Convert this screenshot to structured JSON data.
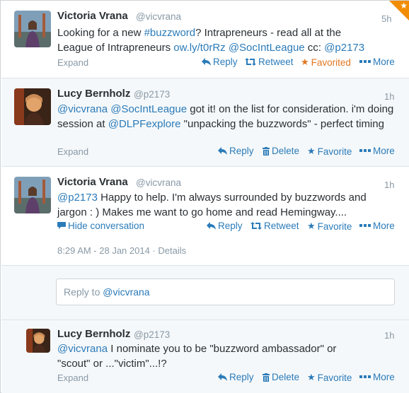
{
  "tweets": [
    {
      "name": "Victoria Vrana",
      "handle": "@vicvrana",
      "time": "5h",
      "text_parts": [
        "Looking for a new ",
        "#buzzword",
        "?  Intrapreneurs - read all at the League of Intrapreneurs ",
        "ow.ly/t0rRz",
        " ",
        "@SocIntLeague",
        " cc: ",
        "@p2173"
      ],
      "expand": "Expand",
      "actions": {
        "reply": "Reply",
        "retweet": "Retweet",
        "favorite": "Favorited",
        "more": "More"
      }
    },
    {
      "name": "Lucy Bernholz",
      "handle": "@p2173",
      "time": "1h",
      "text_parts": [
        "@vicvrana",
        " ",
        "@SocIntLeague",
        " got it! on the list for consideration. i'm doing session at ",
        "@DLPFexplore",
        " \"unpacking the buzzwords\" - perfect timing"
      ],
      "expand": "Expand",
      "actions": {
        "reply": "Reply",
        "delete": "Delete",
        "favorite": "Favorite",
        "more": "More"
      }
    },
    {
      "name": "Victoria Vrana",
      "handle": "@vicvrana",
      "time": "1h",
      "text_parts": [
        "@p2173",
        " Happy to help.  I'm always surrounded by buzzwords and jargon : )  Makes me want to go home and read Hemingway...."
      ],
      "hide": "Hide conversation",
      "actions": {
        "reply": "Reply",
        "retweet": "Retweet",
        "favorite": "Favorite",
        "more": "More"
      },
      "timestamp": "8:29 AM - 28 Jan 2014",
      "details": "Details"
    },
    {
      "name": "Lucy Bernholz",
      "handle": "@p2173",
      "time": "1h",
      "text_parts": [
        "@vicvrana",
        " I nominate you to be \"buzzword ambassador\" or \"scout\" or ...\"victim\"...!?"
      ],
      "expand": "Expand",
      "actions": {
        "reply": "Reply",
        "delete": "Delete",
        "favorite": "Favorite",
        "more": "More"
      }
    }
  ],
  "reply_box": {
    "placeholder": "Reply to ",
    "mention": "@vicvrana"
  },
  "colors": {
    "link": "#2b7bb9",
    "favorited": "#e1771f",
    "muted": "#8899a6",
    "text": "#292f33"
  },
  "icons": [
    "reply-icon",
    "retweet-icon",
    "star-icon",
    "more-icon",
    "delete-icon",
    "conversation-icon"
  ]
}
